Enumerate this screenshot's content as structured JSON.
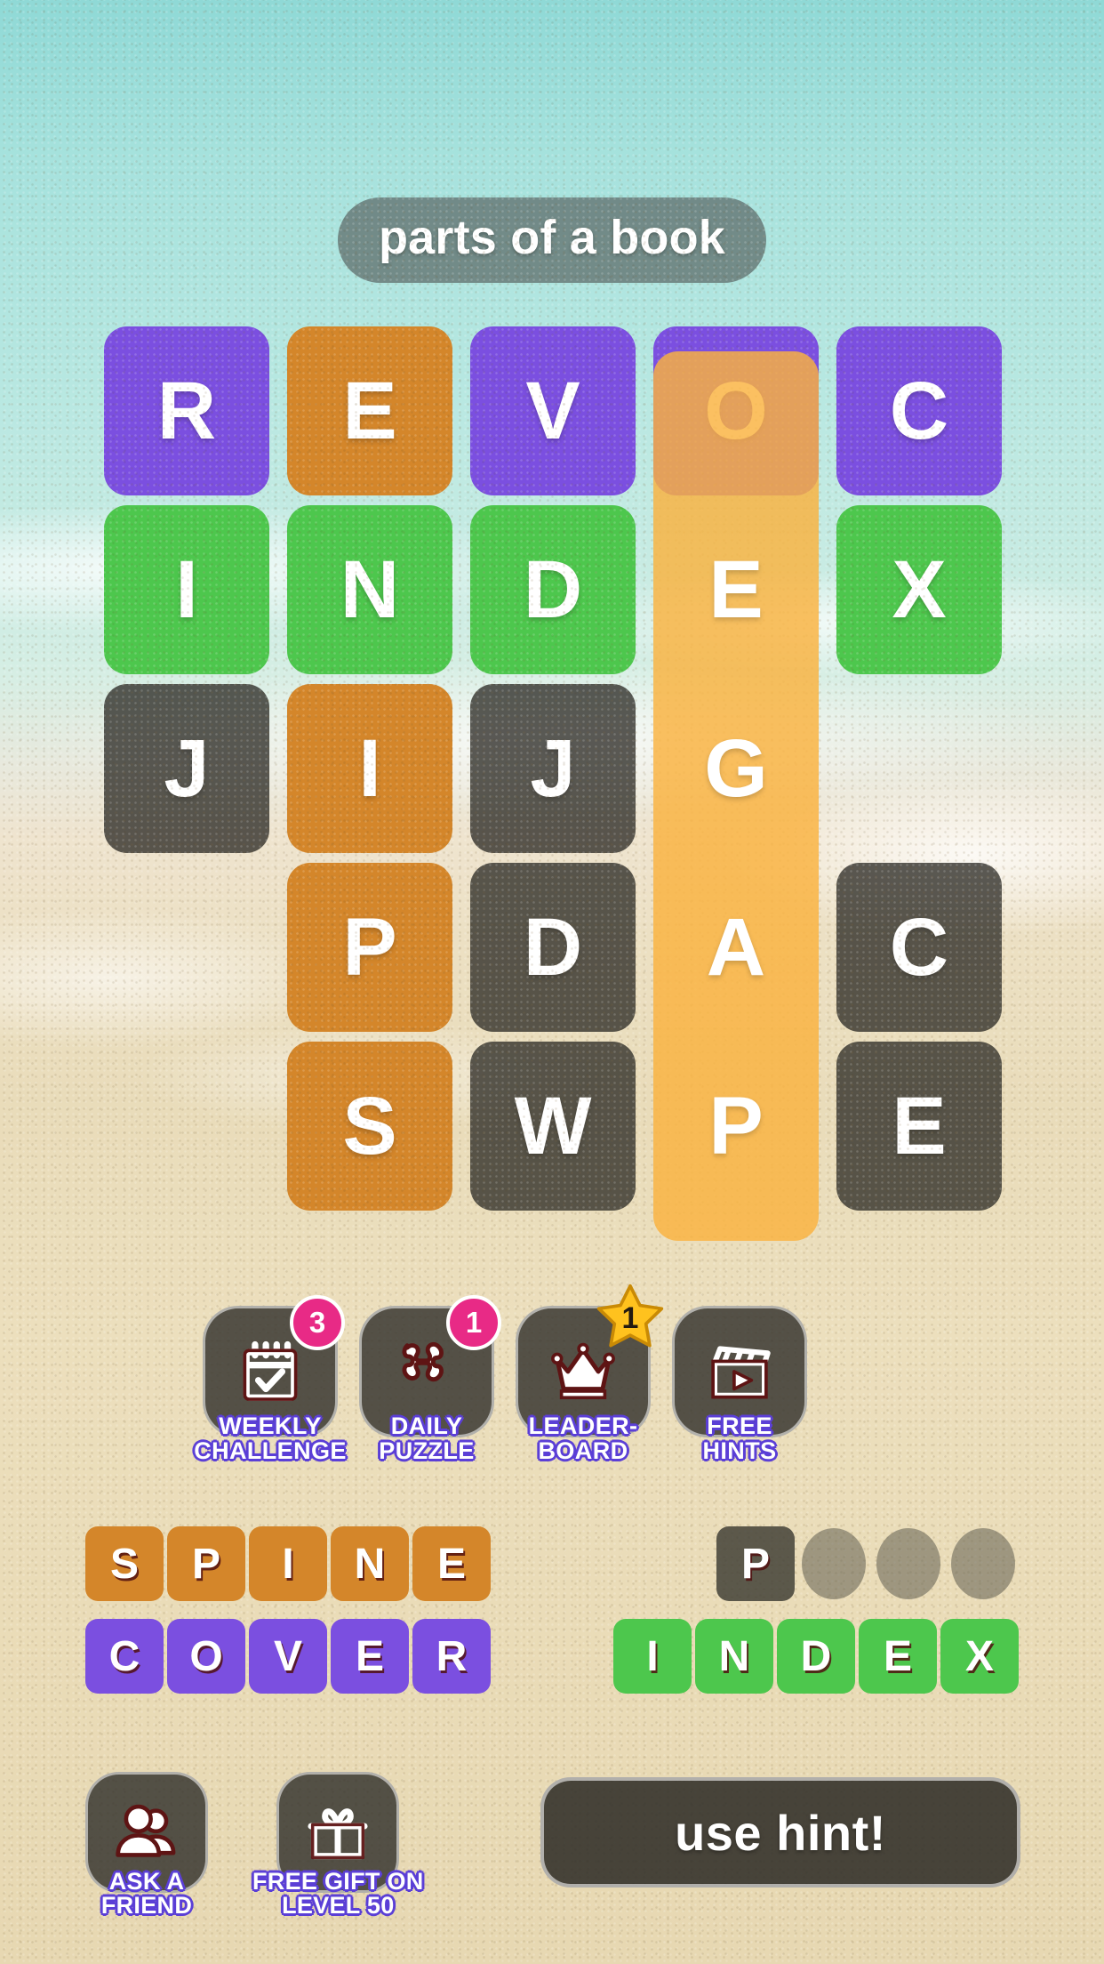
{
  "clue": {
    "text": "parts of a book"
  },
  "grid": {
    "rows": [
      [
        {
          "letter": "R",
          "state": "purple"
        },
        {
          "letter": "E",
          "state": "orange"
        },
        {
          "letter": "V",
          "state": "purple"
        },
        {
          "letter": "O",
          "state": "purple"
        },
        {
          "letter": "C",
          "state": "purple"
        }
      ],
      [
        {
          "letter": "I",
          "state": "green"
        },
        {
          "letter": "N",
          "state": "green"
        },
        {
          "letter": "D",
          "state": "green"
        },
        {
          "letter": "E",
          "state": "selected"
        },
        {
          "letter": "X",
          "state": "green"
        }
      ],
      [
        {
          "letter": "J",
          "state": "dark"
        },
        {
          "letter": "I",
          "state": "orange"
        },
        {
          "letter": "J",
          "state": "dark"
        },
        {
          "letter": "G",
          "state": "selected"
        },
        {
          "letter": "",
          "state": "empty"
        }
      ],
      [
        {
          "letter": "",
          "state": "empty"
        },
        {
          "letter": "P",
          "state": "orange"
        },
        {
          "letter": "D",
          "state": "dark"
        },
        {
          "letter": "A",
          "state": "selected"
        },
        {
          "letter": "C",
          "state": "dark"
        }
      ],
      [
        {
          "letter": "",
          "state": "empty"
        },
        {
          "letter": "S",
          "state": "orange"
        },
        {
          "letter": "W",
          "state": "dark"
        },
        {
          "letter": "P",
          "state": "selected"
        },
        {
          "letter": "E",
          "state": "dark"
        }
      ]
    ]
  },
  "features": [
    {
      "id": "weekly-challenge",
      "label_line1": "WEEKLY",
      "label_line2": "CHALLENGE",
      "icon": "calendar-check-icon",
      "badge": "3",
      "badge_type": "circle"
    },
    {
      "id": "daily-puzzle",
      "label_line1": "DAILY",
      "label_line2": "PUZZLE",
      "icon": "puzzle-piece-icon",
      "badge": "1",
      "badge_type": "circle"
    },
    {
      "id": "leaderboard",
      "label_line1": "LEADER-",
      "label_line2": "BOARD",
      "icon": "crown-icon",
      "badge": "1",
      "badge_type": "star"
    },
    {
      "id": "free-hints",
      "label_line1": "FREE",
      "label_line2": "HINTS",
      "icon": "clapperboard-icon",
      "badge": "",
      "badge_type": "none"
    }
  ],
  "answers": [
    {
      "left": {
        "word": "SPINE",
        "color": "orange",
        "letters": [
          "S",
          "P",
          "I",
          "N",
          "E"
        ]
      },
      "right": {
        "word": "P",
        "color": "dark",
        "letters": [
          "P"
        ],
        "blanks": 3
      }
    },
    {
      "left": {
        "word": "COVER",
        "color": "purple",
        "letters": [
          "C",
          "O",
          "V",
          "E",
          "R"
        ]
      },
      "right": {
        "word": "INDEX",
        "color": "green",
        "letters": [
          "I",
          "N",
          "D",
          "E",
          "X"
        ],
        "blanks": 0
      }
    }
  ],
  "bottom": {
    "ask_friend": {
      "label_line1": "ASK A",
      "label_line2": "FRIEND",
      "icon": "people-icon"
    },
    "free_gift": {
      "label_line1": "FREE GIFT ON",
      "label_line2": "LEVEL 50",
      "icon": "gift-icon"
    },
    "use_hint_label": "use hint!"
  },
  "colors": {
    "purple": "#7B4FE0",
    "green": "#4DC74D",
    "orange": "#D4862A",
    "selected": "#FAB23E",
    "dark": "#2D2C26",
    "badge_pink": "#E82A86",
    "label_outline": "#5B3FD6",
    "water": "#9EE0DC",
    "sand": "#E9DCBA"
  }
}
